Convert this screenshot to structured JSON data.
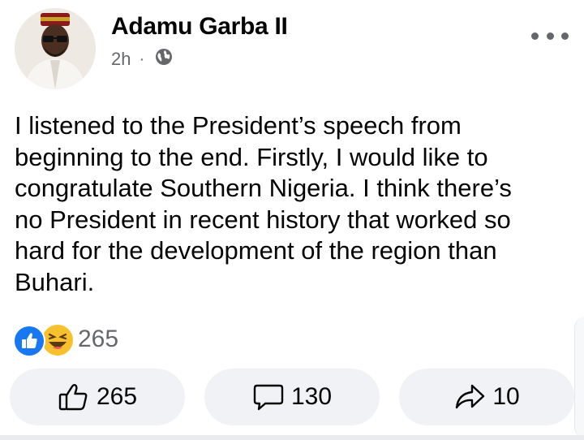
{
  "post": {
    "author": "Adamu Garba II",
    "time": "2h",
    "separator": "·",
    "audience_icon": "globe-icon",
    "more_icon": "more-options-icon",
    "text": "I listened to the President’s speech from\nbeginning to the end. Firstly, I would like to\ncongratulate Southern Nigeria. I think there’s\nno President in recent history that worked so\nhard for the development of the region than\nBuhari."
  },
  "reactions": {
    "icons": [
      "like-reaction-icon",
      "haha-reaction-icon"
    ],
    "count": "265"
  },
  "actions": {
    "like_count": "265",
    "comment_count": "130",
    "share_count": "10"
  },
  "colors": {
    "like_blue": "#1877f2",
    "haha_yellow": "#f7c12d",
    "button_bg": "#f0f2f5",
    "secondary_text": "#65676b"
  }
}
